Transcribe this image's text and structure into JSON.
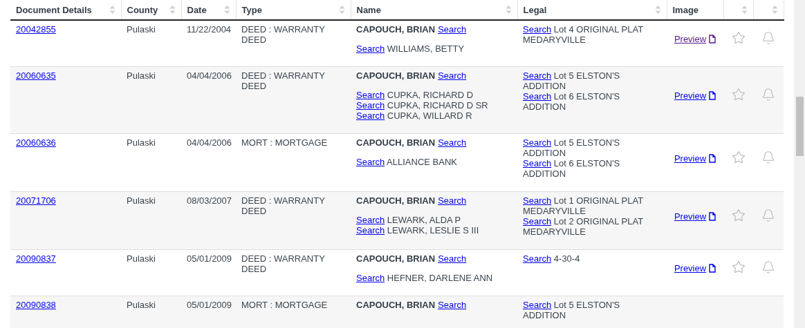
{
  "columns": [
    {
      "label": "Document Details",
      "sortable": true
    },
    {
      "label": "County",
      "sortable": true
    },
    {
      "label": "Date",
      "sortable": true
    },
    {
      "label": "Type",
      "sortable": true
    },
    {
      "label": "Name",
      "sortable": true
    },
    {
      "label": "Legal",
      "sortable": true
    },
    {
      "label": "Image",
      "sortable": false
    },
    {
      "sortable": true
    },
    {
      "sortable": true
    }
  ],
  "rows": [
    {
      "document": "20042855",
      "county": "Pulaski",
      "date": "11/22/2004",
      "type": "DEED : WARRANTY DEED",
      "owner": {
        "name": "CAPOUCH, BRIAN",
        "link": "Search"
      },
      "parties": [
        {
          "link": "Search",
          "name": "WILLIAMS, BETTY"
        }
      ],
      "legal": [
        {
          "link": "Search",
          "text": "Lot 4 ORIGINAL PLAT MEDARYVILLE"
        }
      ],
      "preview": {
        "label": "Preview",
        "visited": true
      },
      "starred": false,
      "alert": false
    },
    {
      "document": "20060635",
      "county": "Pulaski",
      "date": "04/04/2006",
      "type": "DEED : WARRANTY DEED",
      "owner": {
        "name": "CAPOUCH, BRIAN",
        "link": "Search"
      },
      "parties": [
        {
          "link": "Search",
          "name": "CUPKA, RICHARD D"
        },
        {
          "link": "Search",
          "name": "CUPKA, RICHARD D SR"
        },
        {
          "link": "Search",
          "name": "CUPKA, WILLARD R"
        }
      ],
      "legal": [
        {
          "link": "Search",
          "text": "Lot 5 ELSTON'S ADDITION"
        },
        {
          "link": "Search",
          "text": "Lot 6 ELSTON'S ADDITION"
        }
      ],
      "preview": {
        "label": "Preview",
        "visited": false
      },
      "starred": false,
      "alert": false
    },
    {
      "document": "20060636",
      "county": "Pulaski",
      "date": "04/04/2006",
      "type": "MORT : MORTGAGE",
      "owner": {
        "name": "CAPOUCH, BRIAN",
        "link": "Search"
      },
      "parties": [
        {
          "link": "Search",
          "name": "ALLIANCE BANK"
        }
      ],
      "legal": [
        {
          "link": "Search",
          "text": "Lot 5 ELSTON'S ADDITION"
        },
        {
          "link": "Search",
          "text": "Lot 6 ELSTON'S ADDITION"
        }
      ],
      "preview": {
        "label": "Preview",
        "visited": false
      },
      "starred": false,
      "alert": false
    },
    {
      "document": "20071706",
      "county": "Pulaski",
      "date": "08/03/2007",
      "type": "DEED : WARRANTY DEED",
      "owner": {
        "name": "CAPOUCH, BRIAN",
        "link": "Search"
      },
      "parties": [
        {
          "link": "Search",
          "name": "LEWARK, ALDA P"
        },
        {
          "link": "Search",
          "name": "LEWARK, LESLIE S III"
        }
      ],
      "legal": [
        {
          "link": "Search",
          "text": "Lot 1 ORIGINAL PLAT MEDARYVILLE"
        },
        {
          "link": "Search",
          "text": "Lot 2 ORIGINAL PLAT MEDARYVILLE"
        }
      ],
      "preview": {
        "label": "Preview",
        "visited": false
      },
      "starred": false,
      "alert": false
    },
    {
      "document": "20090837",
      "county": "Pulaski",
      "date": "05/01/2009",
      "type": "DEED : WARRANTY DEED",
      "owner": {
        "name": "CAPOUCH, BRIAN",
        "link": "Search"
      },
      "parties": [
        {
          "link": "Search",
          "name": "HEFNER, DARLENE ANN"
        }
      ],
      "legal": [
        {
          "link": "Search",
          "text": "4-30-4"
        }
      ],
      "preview": {
        "label": "Preview",
        "visited": false
      },
      "starred": false,
      "alert": false
    },
    {
      "document": "20090838",
      "county": "Pulaski",
      "date": "05/01/2009",
      "type": "MORT : MORTGAGE",
      "owner": {
        "name": "CAPOUCH, BRIAN",
        "link": "Search"
      },
      "legal": [
        {
          "link": "Search",
          "text": "Lot 5 ELSTON'S ADDITION"
        }
      ]
    }
  ]
}
